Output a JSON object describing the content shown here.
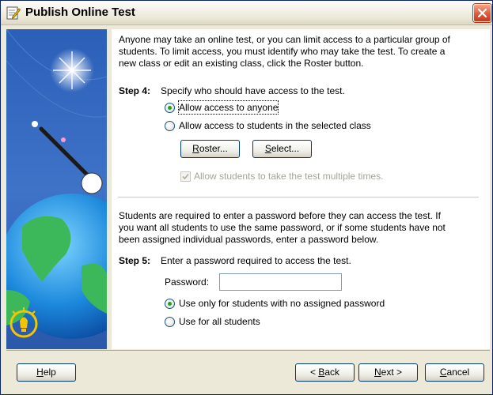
{
  "window": {
    "title": "Publish Online Test"
  },
  "intro": [
    "Anyone may take an online test, or you can limit access to a particular group of",
    "students.  To limit access, you must identify who may take the test.  To create a",
    "new class or edit an existing class, click the Roster button."
  ],
  "step4": {
    "label": "Step 4:",
    "text": "Specify who should have access to the test.",
    "options": [
      {
        "label": "Allow access to anyone",
        "selected": true
      },
      {
        "label": "Allow access to students in the selected class",
        "selected": false
      }
    ],
    "roster_button": {
      "hotkey": "R",
      "rest": "oster..."
    },
    "select_button": {
      "hotkey": "S",
      "rest": "elect..."
    },
    "multiple_times": {
      "label": "Allow students to take the test multiple times.",
      "checked": true,
      "enabled": false
    }
  },
  "password_intro": [
    "Students are required to enter a password before they can access the test.  If",
    "you want all students to use the same password, or if some students have not",
    "been assigned individual passwords, enter a password below."
  ],
  "step5": {
    "label": "Step 5:",
    "text": "Enter a password required to access the test.",
    "password_label": "Password:",
    "password_value": "",
    "options": [
      {
        "label": "Use only for students with no assigned password",
        "selected": true
      },
      {
        "label": "Use for all students",
        "selected": false
      }
    ]
  },
  "footer": {
    "help": {
      "hotkey": "H",
      "rest": "elp"
    },
    "back": {
      "prefix": "< ",
      "hotkey": "B",
      "rest": "ack"
    },
    "next": {
      "hotkey": "N",
      "rest": "ext >"
    },
    "cancel": {
      "hotkey": "C",
      "rest": "ancel"
    }
  },
  "colors": {
    "title_bar": "#ece9d8",
    "close_button": "#e25a38",
    "radio_dot": "#21a121",
    "side_panel": "#3f73c8"
  }
}
